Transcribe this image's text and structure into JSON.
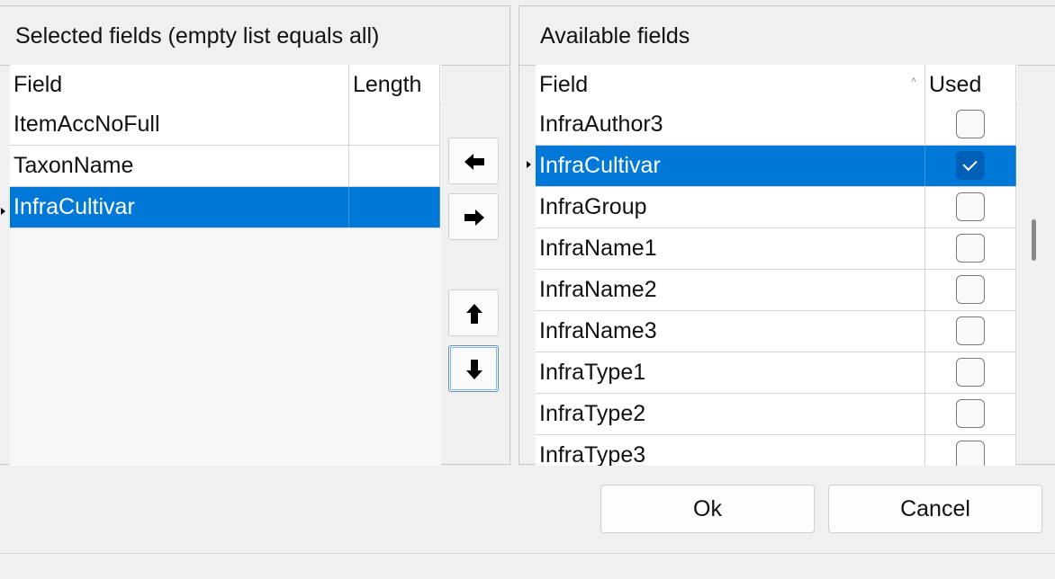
{
  "selected_panel": {
    "title": "Selected fields (empty list equals all)",
    "columns": [
      "Field",
      "Length"
    ],
    "rows": [
      {
        "field": "ItemAccNoFull",
        "length": "",
        "selected": false
      },
      {
        "field": "TaxonName",
        "length": "",
        "selected": false
      },
      {
        "field": "InfraCultivar",
        "length": "",
        "selected": true
      }
    ]
  },
  "available_panel": {
    "title": "Available fields",
    "columns": [
      "Field",
      "Used"
    ],
    "sort_indicator": "˄",
    "rows": [
      {
        "field": "InfraAuthor3",
        "used": false,
        "selected": false
      },
      {
        "field": "InfraCultivar",
        "used": true,
        "selected": true
      },
      {
        "field": "InfraGroup",
        "used": false,
        "selected": false
      },
      {
        "field": "InfraName1",
        "used": false,
        "selected": false
      },
      {
        "field": "InfraName2",
        "used": false,
        "selected": false
      },
      {
        "field": "InfraName3",
        "used": false,
        "selected": false
      },
      {
        "field": "InfraType1",
        "used": false,
        "selected": false
      },
      {
        "field": "InfraType2",
        "used": false,
        "selected": false
      },
      {
        "field": "InfraType3",
        "used": false,
        "selected": false
      }
    ]
  },
  "move_buttons": [
    {
      "name": "move-left-button",
      "icon": "arrow-left-icon"
    },
    {
      "name": "move-right-button",
      "icon": "arrow-right-icon"
    },
    {
      "name": "move-up-button",
      "icon": "arrow-up-icon"
    },
    {
      "name": "move-down-button",
      "icon": "arrow-down-icon"
    }
  ],
  "footer": {
    "ok_label": "Ok",
    "cancel_label": "Cancel"
  }
}
